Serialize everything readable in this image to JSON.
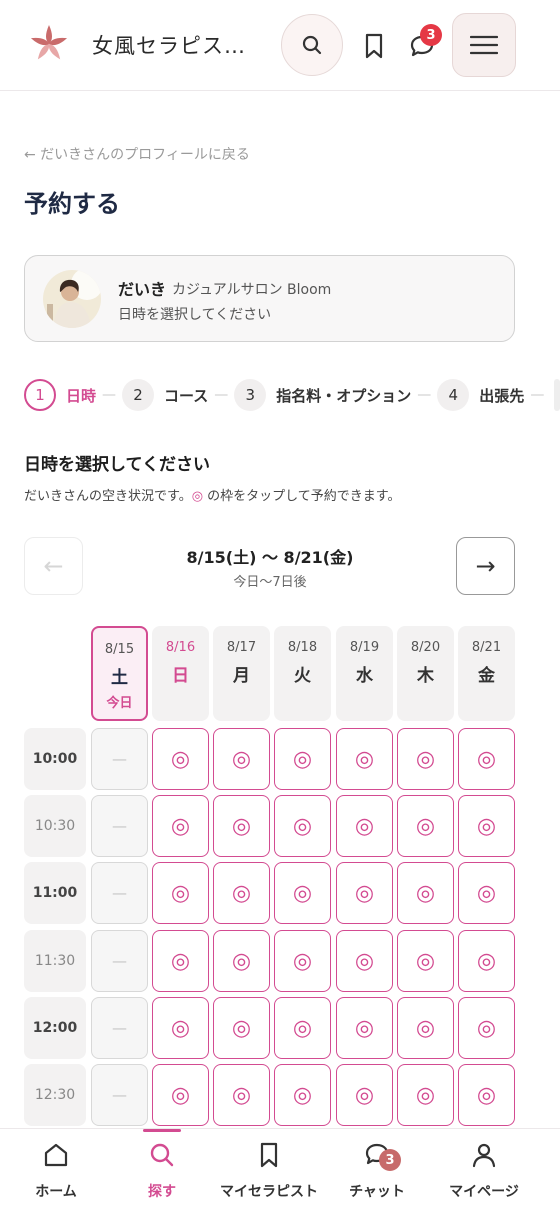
{
  "header": {
    "title": "女風セラピス…",
    "chat_badge": "3"
  },
  "back_link": "← だいきさんのプロフィールに戻る",
  "page_title": "予約する",
  "therapist": {
    "name": "だいき",
    "salon": "カジュアルサロン Bloom",
    "subtitle": "日時を選択してください"
  },
  "steps": [
    {
      "num": "1",
      "label": "日時",
      "active": true
    },
    {
      "num": "2",
      "label": "コース"
    },
    {
      "num": "3",
      "label": "指名料・オプション"
    },
    {
      "num": "4",
      "label": "出張先"
    }
  ],
  "section": {
    "title": "日時を選択してください",
    "desc_before": "だいきさんの空き状況です。",
    "desc_mark": "◎",
    "desc_after": " の枠をタップして予約できます。"
  },
  "week": {
    "range": "8/15(土) 〜 8/21(金)",
    "sub": "今日〜7日後",
    "prev": "←",
    "next": "→"
  },
  "days": [
    {
      "date": "8/15",
      "dow": "土",
      "today_label": "今日"
    },
    {
      "date": "8/16",
      "dow": "日"
    },
    {
      "date": "8/17",
      "dow": "月"
    },
    {
      "date": "8/18",
      "dow": "火"
    },
    {
      "date": "8/19",
      "dow": "水"
    },
    {
      "date": "8/20",
      "dow": "木"
    },
    {
      "date": "8/21",
      "dow": "金"
    }
  ],
  "times": [
    "10:00",
    "10:30",
    "11:00",
    "11:30",
    "12:00",
    "12:30"
  ],
  "slot_symbols": {
    "available": "◎",
    "unavailable": "—"
  },
  "bottom_nav": [
    {
      "label": "ホーム"
    },
    {
      "label": "探す",
      "active": true
    },
    {
      "label": "マイセラピスト"
    },
    {
      "label": "チャット",
      "badge": "3"
    },
    {
      "label": "マイページ"
    }
  ],
  "colors": {
    "accent": "#d34b91",
    "badge": "#e53845"
  }
}
